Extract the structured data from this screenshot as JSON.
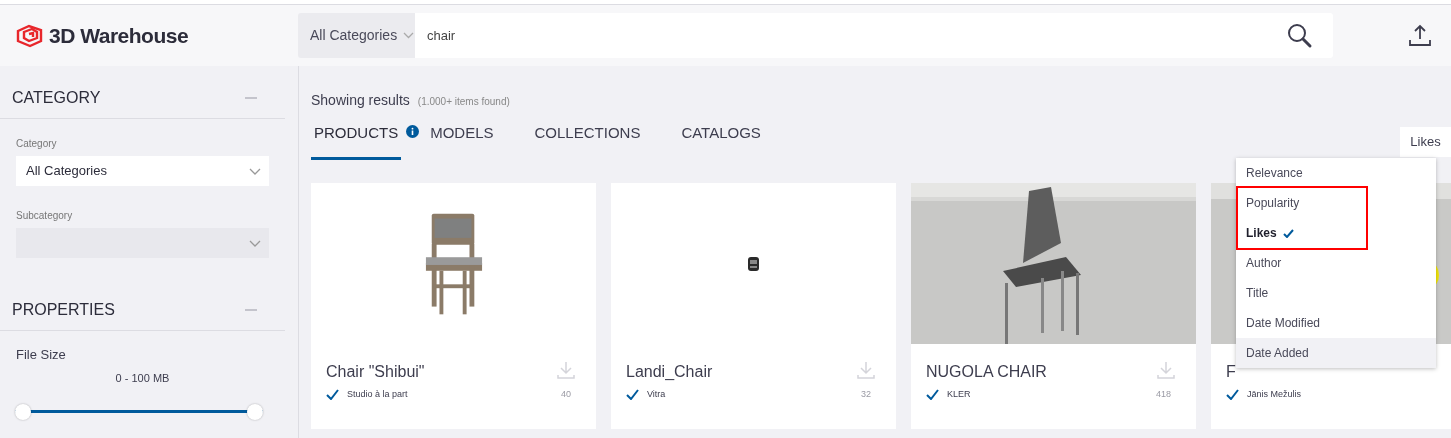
{
  "header": {
    "logo": "3D Warehouse",
    "search": {
      "category": "All Categories",
      "value": "chair"
    }
  },
  "sidebar": {
    "sections": [
      {
        "title": "CATEGORY",
        "expanded": true,
        "fields": [
          {
            "kind": "select",
            "label": "Category",
            "value": "All Categories",
            "disabled": false
          },
          {
            "kind": "select",
            "label": "Subcategory",
            "disabled": true
          }
        ]
      },
      {
        "title": "PROPERTIES",
        "expanded": true,
        "fields": [
          {
            "kind": "range",
            "label": "File Size",
            "reading": "0 - 100 MB",
            "level": 1
          }
        ]
      }
    ]
  },
  "results": {
    "heading": "Showing results",
    "count": "(1.000+ items found)"
  },
  "tabs": [
    {
      "label": "PRODUCTS",
      "selected": true,
      "info": true
    },
    {
      "label": "MODELS",
      "selected": false,
      "info": false
    },
    {
      "label": "COLLECTIONS",
      "selected": false,
      "info": false
    },
    {
      "label": "CATALOGS",
      "selected": false,
      "info": false
    }
  ],
  "sort": {
    "label": "Likes",
    "options": [
      {
        "label": "Relevance",
        "selected": false,
        "hovered": false,
        "annotated": false
      },
      {
        "label": "Popularity",
        "selected": false,
        "hovered": false,
        "annotated": true
      },
      {
        "label": "Likes",
        "selected": true,
        "hovered": false,
        "annotated": true
      },
      {
        "label": "Author",
        "selected": false,
        "hovered": false,
        "annotated": false
      },
      {
        "label": "Title",
        "selected": false,
        "hovered": false,
        "annotated": false
      },
      {
        "label": "Date Modified",
        "selected": false,
        "hovered": false,
        "annotated": false
      },
      {
        "label": "Date Added",
        "selected": false,
        "hovered": true,
        "annotated": false
      }
    ]
  },
  "cards": [
    {
      "title": "Chair \"Shibui\"",
      "author": "Studio à la part",
      "verified": true,
      "downloads": "40"
    },
    {
      "title": "Landi_Chair",
      "author": "Vitra",
      "verified": true,
      "downloads": "32"
    },
    {
      "title": "NUGOLA CHAIR",
      "author": "KLER",
      "verified": true,
      "downloads": "418"
    },
    {
      "title": "F",
      "author": "Jānis Mežulis",
      "verified": true
    }
  ]
}
